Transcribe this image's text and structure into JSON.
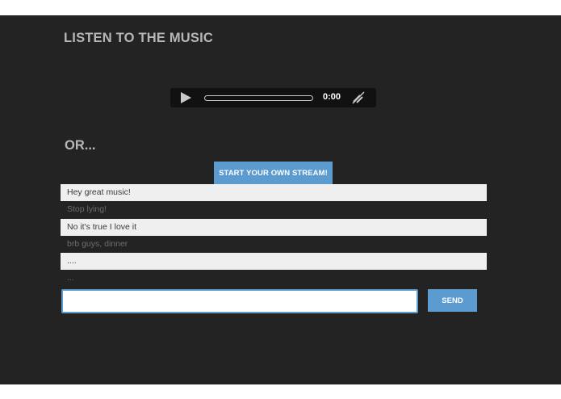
{
  "header": {
    "title": "LISTEN TO THE MUSIC"
  },
  "player": {
    "time": "0:00",
    "icons": {
      "play": "play-icon",
      "mute": "mute-icon"
    },
    "progress": 0
  },
  "section": {
    "or_label": "OR..."
  },
  "actions": {
    "start_stream_label": "START YOUR OWN STREAM!"
  },
  "chat": {
    "messages": [
      {
        "text": "Hey great music!"
      },
      {
        "text": "Stop lying!"
      },
      {
        "text": "No it's true I love it"
      },
      {
        "text": "brb guys, dinner"
      },
      {
        "text": "...."
      },
      {
        "text": "..."
      }
    ],
    "input": {
      "value": "",
      "placeholder": ""
    },
    "send_label": "SEND"
  },
  "colors": {
    "background": "#232323",
    "accent": "#5b9bd0",
    "row_light": "#efefef",
    "title_gray": "#b7b7b7"
  }
}
